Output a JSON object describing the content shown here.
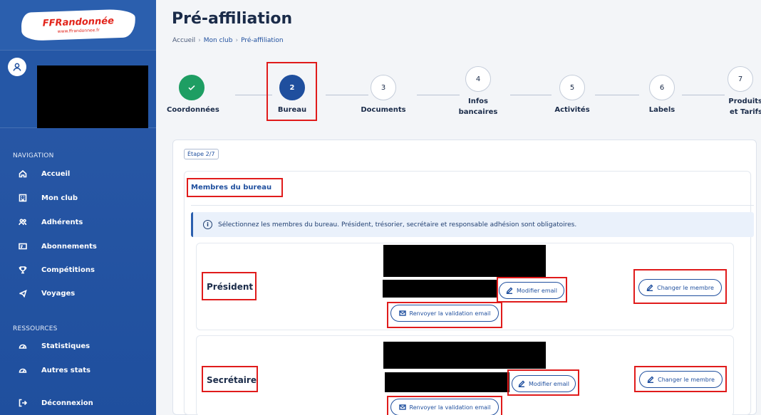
{
  "sidebar": {
    "logo": {
      "brand": "FFRandonnée",
      "url": "www.ffrandonnee.fr"
    },
    "navigation_title": "NAVIGATION",
    "nav_items": [
      {
        "label": "Accueil",
        "icon": "home-icon"
      },
      {
        "label": "Mon club",
        "icon": "building-icon"
      },
      {
        "label": "Adhérents",
        "icon": "users-icon"
      },
      {
        "label": "Abonnements",
        "icon": "card-icon"
      },
      {
        "label": "Compétitions",
        "icon": "trophy-icon"
      },
      {
        "label": "Voyages",
        "icon": "plane-icon"
      }
    ],
    "resources_title": "RESSOURCES",
    "resource_items": [
      {
        "label": "Statistiques",
        "icon": "gauge-icon"
      },
      {
        "label": "Autres stats",
        "icon": "gauge-icon"
      }
    ],
    "logout": {
      "label": "Déconnexion",
      "icon": "logout-icon"
    }
  },
  "header": {
    "title": "Pré-affiliation",
    "breadcrumb": [
      "Accueil",
      "Mon club",
      "Pré-affiliation"
    ]
  },
  "stepper": {
    "steps": [
      {
        "number": "",
        "label": "Coordonnées",
        "state": "done"
      },
      {
        "number": "2",
        "label": "Bureau",
        "state": "active"
      },
      {
        "number": "3",
        "label": "Documents",
        "state": "todo"
      },
      {
        "number": "4",
        "label": "Infos bancaires",
        "state": "todo"
      },
      {
        "number": "5",
        "label": "Activités",
        "state": "todo"
      },
      {
        "number": "6",
        "label": "Labels",
        "state": "todo"
      },
      {
        "number": "7",
        "label": "Produits et Tarifs",
        "state": "todo"
      }
    ]
  },
  "form": {
    "step_badge": "Étape 2/7",
    "section_title": "Membres du bureau",
    "info_message": "Sélectionnez les membres du bureau. Président, trésorier, secrétaire et responsable adhésion sont obligatoires.",
    "members": [
      {
        "role": "Président",
        "modify_email_label": "Modifier email",
        "resend_validation_label": "Renvoyer la validation email",
        "change_member_label": "Changer le membre"
      },
      {
        "role": "Secrétaire",
        "modify_email_label": "Modifier email",
        "resend_validation_label": "Renvoyer la validation email",
        "change_member_label": "Changer le membre"
      }
    ]
  },
  "colors": {
    "sidebar": "#2157a6",
    "accent": "#1f4f9e",
    "done": "#1e9e63",
    "highlight": "#e01b1b"
  }
}
